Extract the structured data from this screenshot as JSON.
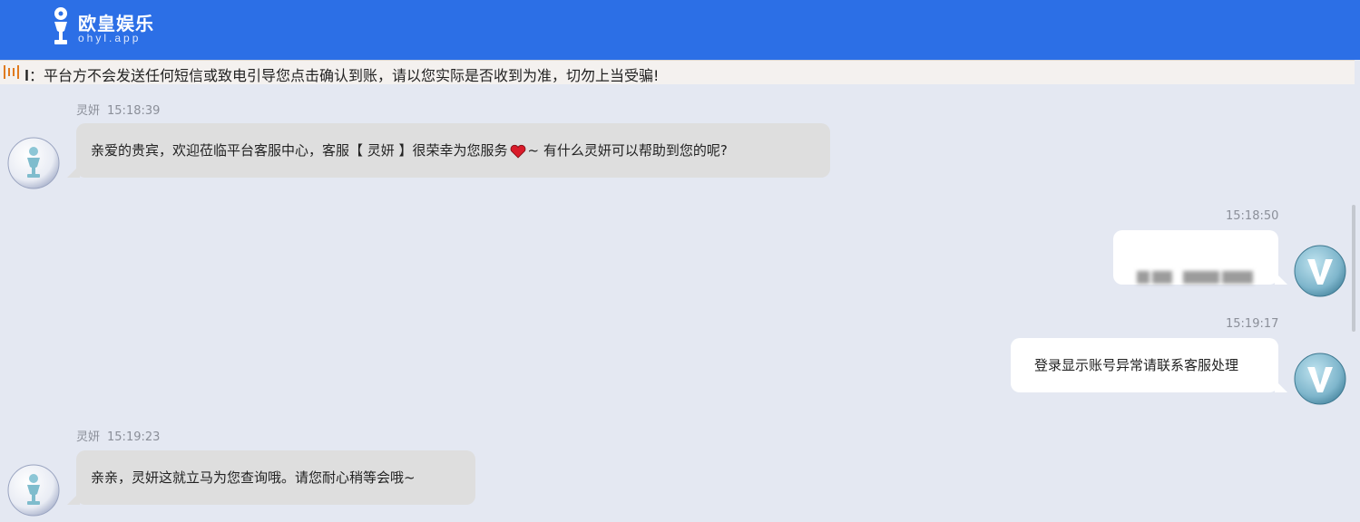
{
  "header": {
    "brand_name": "欧皇娱乐",
    "brand_domain": "ohyl.app",
    "background": "#2c6fe6"
  },
  "notice": {
    "icon": "bars-icon",
    "text": "𝐈：平台方不会发送任何短信或致电引导您点击确认到账，请以您实际是否收到为准，切勿上当受骗!"
  },
  "messages": [
    {
      "side": "agent",
      "sender": "灵妍",
      "time": "15:18:39",
      "text_before": "亲爱的贵宾，欢迎莅临平台客服中心，客服【 灵妍 】很荣幸为您服务",
      "emoji": "heart-icon",
      "text_after": "~ 有什么灵妍可以帮助到您的呢?",
      "avatar": "trophy-avatar"
    },
    {
      "side": "user",
      "time": "15:18:50",
      "text": "[redacted]",
      "avatar": "v-avatar"
    },
    {
      "side": "user",
      "time": "15:19:17",
      "text": "登录显示账号异常请联系客服处理",
      "avatar": "v-avatar"
    },
    {
      "side": "agent",
      "sender": "灵妍",
      "time": "15:19:23",
      "text": "亲亲，灵妍这就立马为您查询哦。请您耐心稍等会哦~",
      "avatar": "trophy-avatar"
    }
  ],
  "colors": {
    "chat_background": "#e4e8f2",
    "agent_bubble": "#dedede",
    "user_bubble": "#ffffff",
    "notice_background": "#f4f1ef",
    "accent": "#2c6fe6"
  }
}
